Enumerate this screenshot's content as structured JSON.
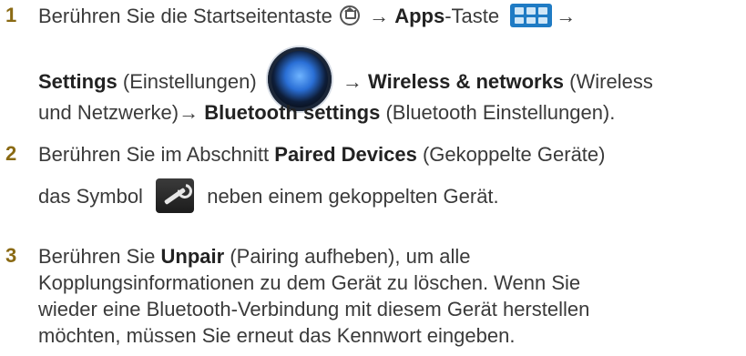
{
  "step1": {
    "number": "1",
    "line1_text1": "Berühren Sie die Startseitentaste",
    "line1_arrow1": "→",
    "line1_apps_bold": "Apps",
    "line1_apps_rest": "-Taste",
    "line1_arrow2": "→",
    "line2_settings_bold": "Settings",
    "line2_settings_rest": "(Einstellungen)",
    "line2_arrow": "→",
    "line2_wireless_bold": "Wireless & networks",
    "line2_wireless_rest": "(Wireless",
    "line3_text": "und Netzwerke)→",
    "line3_bt_bold": "Bluetooth settings",
    "line3_bt_rest": "(Bluetooth Einstellungen).",
    "icons": [
      "home-icon",
      "apps-icon",
      "settings-icon"
    ]
  },
  "step2": {
    "number": "2",
    "line1_text1": "Berühren Sie im Abschnitt",
    "line1_bold": "Paired Devices",
    "line1_rest": "(Gekoppelte Geräte)",
    "line2_text1": "das Symbol",
    "line2_text2": "neben einem gekoppelten Gerät.",
    "icons": [
      "wrench-icon"
    ]
  },
  "step3": {
    "number": "3",
    "line1_text1": "Berühren Sie",
    "line1_bold": "Unpair",
    "line1_rest": "(Pairing aufheben), um alle",
    "line2": "Kopplungsinformationen zu dem Gerät zu löschen. Wenn Sie",
    "line3": "wieder eine Bluetooth-Verbindung mit diesem Gerät herstellen",
    "line4": "möchten, müssen Sie erneut das Kennwort eingeben."
  },
  "colors": {
    "step_number": "#8a6a14",
    "apps_icon": "#1f7bc4",
    "text": "#3a3a3a"
  }
}
